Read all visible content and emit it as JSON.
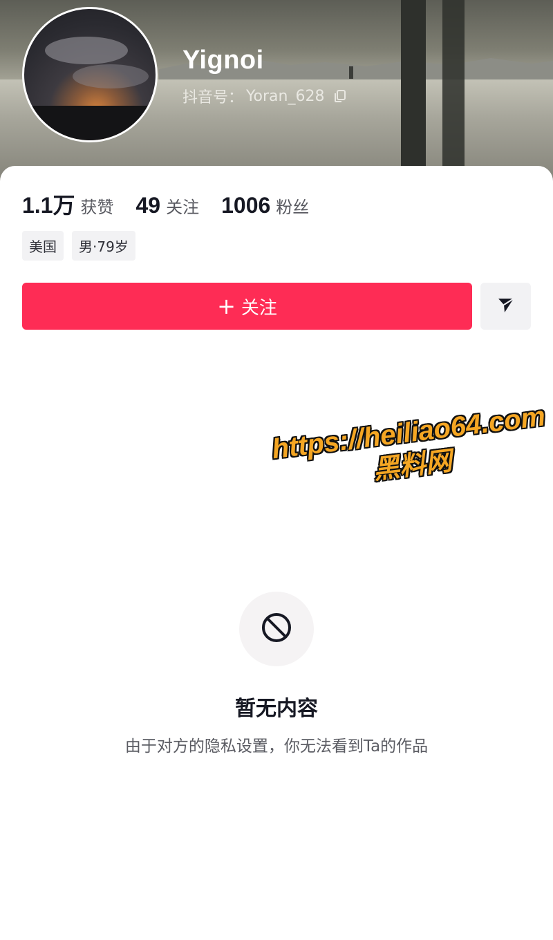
{
  "profile": {
    "name": "Yignoi",
    "id_label": "抖音号：",
    "id_value": "Yoran_628"
  },
  "stats": {
    "likes": {
      "value": "1.1万",
      "label": "获赞"
    },
    "following": {
      "value": "49",
      "label": "关注"
    },
    "followers": {
      "value": "1006",
      "label": "粉丝"
    }
  },
  "tags": [
    "美国",
    "男·79岁"
  ],
  "actions": {
    "follow_label": "关注",
    "follow_icon": "+",
    "share_icon": "send-arrow-icon"
  },
  "empty_state": {
    "icon": "prohibited-icon",
    "title": "暂无内容",
    "description": "由于对方的隐私设置，你无法看到Ta的作品"
  },
  "watermark": {
    "url": "https://heiliao64.com",
    "name": "黑料网"
  },
  "colors": {
    "accent": "#fe2c55",
    "watermark": "#f5a623"
  }
}
